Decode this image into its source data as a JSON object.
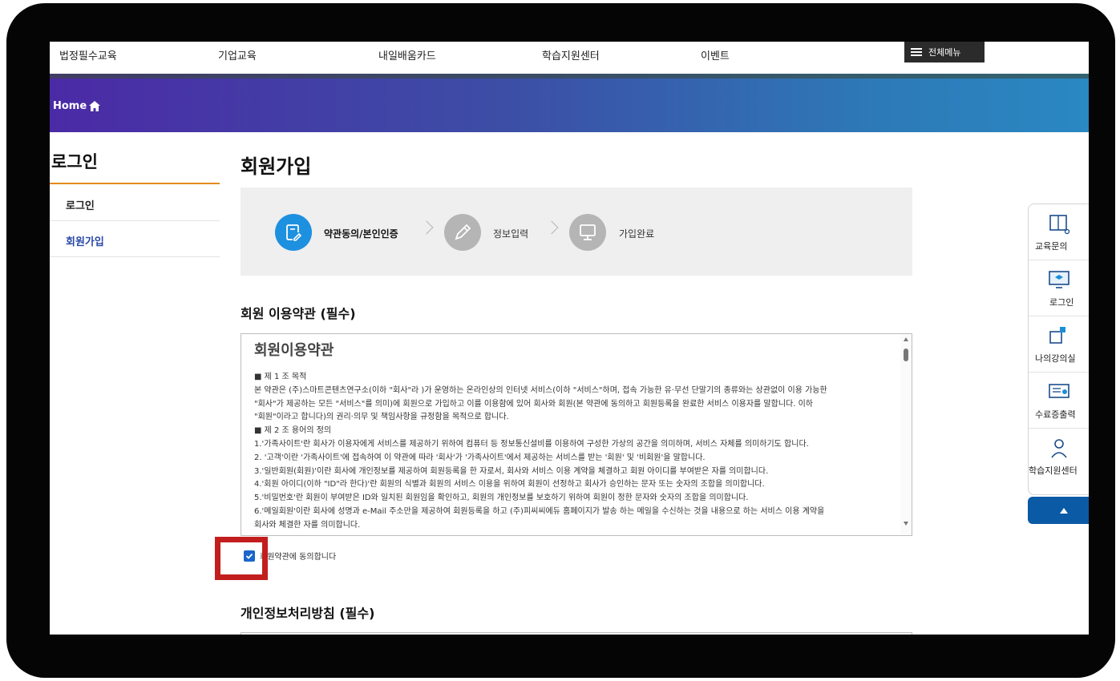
{
  "nav": {
    "items": [
      "법정필수교육",
      "기업교육",
      "내일배움카드",
      "학습지원센터",
      "이벤트"
    ],
    "menu_label": "전체메뉴"
  },
  "breadcrumb": {
    "home": "Home"
  },
  "sidebar": {
    "title": "로그인",
    "items": [
      {
        "label": "로그인"
      },
      {
        "label": "회원가입"
      }
    ]
  },
  "page": {
    "title": "회원가입"
  },
  "steps": [
    {
      "label": "약관동의/본인인증",
      "icon": "note-edit-icon",
      "active": true
    },
    {
      "label": "정보입력",
      "icon": "pencil-icon",
      "active": false
    },
    {
      "label": "가입완료",
      "icon": "monitor-icon",
      "active": false
    }
  ],
  "terms": {
    "section_title": "회원 이용약관 (필수)",
    "heading": "회원이용약관",
    "lines": [
      "■ 제 1 조 목적",
      " 본 약관은 (주)스마트콘텐츠연구소(이하 \"회사\"라 )가 운영하는 온라인상의 인터넷 서비스(이하 \"서비스\"하며, 접속 가능한 유·무선 단말기의 종류와는 상관없이 이용 가능한",
      "\"회사\"가 제공하는 모든 \"서비스\"를 의미)에 회원으로 가입하고 이를 이용함에 있어 회사와 회원(본 약관에 동의하고 회원등록을 완료한 서비스 이용자를 말합니다. 이하",
      "\"회원\"이라고 합니다)의 권리·의무 및 책임사항을 규정함을 목적으로 합니다.",
      "■ 제 2 조 용어의 정의",
      "1.'가족사이트'란 회사가 이용자에게 서비스를 제공하기 위하여 컴퓨터 등 정보통신설비를 이용하여 구성한 가상의 공간을 의미하며, 서비스 자체를 의미하기도 합니다.",
      "2. '고객'이란 '가족사이트'에 접속하여 이 약관에 따라 '회사'가 '가족사이트'에서 제공하는 서비스를 받는 '회원' 및 '비회원'을 말합니다.",
      "3.'일반회원(회원)'이란 회사에 개인정보를 제공하여 회원등록을 한 자로서, 회사와 서비스 이용 계약을 체결하고 회원 아이디를 부여받은 자를 의미합니다.",
      "4.'회원 아이디(이하 \"ID\"라 한다)'란 회원의 식별과 회원의 서비스 이용을 위하여 회원이 선정하고 회사가 승인하는 문자 또는 숫자의 조합을 의미합니다.",
      "5.'비밀번호'란 회원이 부여받은 ID와 일치된 회원임을 확인하고, 회원의 개인정보를 보호하기 위하여 회원이 정한 문자와 숫자의 조합을 의미합니다.",
      "6.'메일회원'이란 회사에 성명과 e-Mail 주소만을 제공하여 회원등록을 하고 (주)피씨씨에듀 홈페이지가 발송 하는 메일을 수신하는 것을 내용으로 하는 서비스 이용 계약을",
      "회사와 체결한 자를 의미합니다."
    ],
    "agree_label": "회원약관에 동의합니다",
    "agreed": true
  },
  "privacy": {
    "section_title": "개인정보처리방침 (필수)"
  },
  "quick_menu": {
    "items": [
      {
        "label": "교육문의",
        "icon": "book-icon"
      },
      {
        "label": "로그인",
        "icon": "monitor-cap-icon"
      },
      {
        "label": "나의강의실",
        "icon": "puzzle-icon"
      },
      {
        "label": "수료증출력",
        "icon": "certificate-icon"
      },
      {
        "label": "학습지원센터",
        "icon": "support-person-icon"
      }
    ],
    "top_button_icon": "arrow-up-icon"
  },
  "colors": {
    "accent_blue": "#2a49a8",
    "step_active": "#1e90e0",
    "step_inactive": "#b5b5b5",
    "highlight_red": "#c31e1e",
    "sidebar_underline": "#e38a1c"
  }
}
